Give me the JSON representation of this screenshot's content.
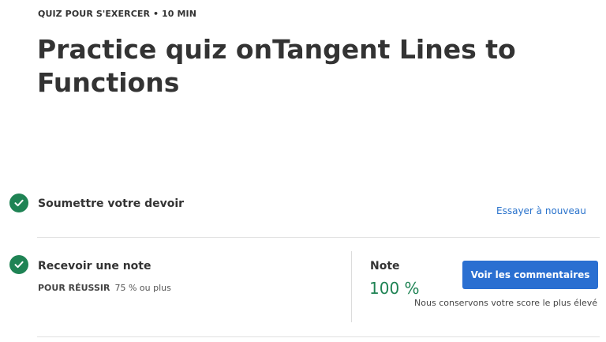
{
  "header": {
    "eyebrow": "QUIZ POUR S'EXERCER • 10 MIN",
    "title": "Practice quiz onTangent Lines to Functions"
  },
  "steps": [
    {
      "label": "Soumettre votre devoir",
      "status": "complete",
      "action_link": "Essayer à nouveau"
    },
    {
      "label": "Recevoir une note",
      "status": "complete",
      "pass_key": "POUR RÉUSSIR",
      "pass_value": "75 % ou plus"
    }
  ],
  "grade": {
    "label": "Note",
    "value": "100 %",
    "button_label": "Voir les commentaires",
    "note": "Nous conservons votre score le plus élevé"
  },
  "colors": {
    "accent_blue": "#2a6fd1",
    "success_green": "#1f8354",
    "link_blue": "#2a73cc"
  },
  "icons": {
    "completed": "checkmark-circle-icon"
  }
}
